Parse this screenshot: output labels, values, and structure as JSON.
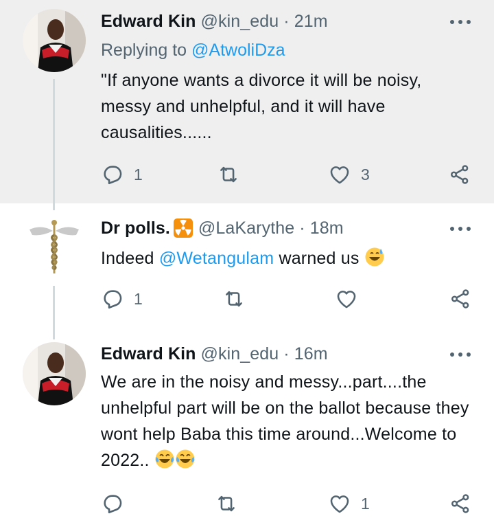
{
  "tweets": [
    {
      "author_name": "Edward Kin",
      "handle": "@kin_edu",
      "separator": "·",
      "time": "21m",
      "replying_prefix": "Replying to",
      "replying_handle": "@AtwoliDza",
      "text": "\"If anyone wants a divorce it will be noisy, messy and unhelpful, and it will have causalities......",
      "reply_count": "1",
      "retweet_count": "",
      "like_count": "3"
    },
    {
      "author_name": "Dr polls.",
      "handle": "@LaKarythe",
      "separator": "·",
      "time": "18m",
      "text_before": "Indeed ",
      "mention": "@Wetangulam",
      "text_after": " warned us",
      "reply_count": "1",
      "retweet_count": "",
      "like_count": ""
    },
    {
      "author_name": "Edward Kin",
      "handle": "@kin_edu",
      "separator": "·",
      "time": "16m",
      "text": "We are in the noisy and messy...part....the unhelpful part will be on the ballot because they wont help Baba this time around...Welcome to 2022..",
      "reply_count": "",
      "retweet_count": "",
      "like_count": "1"
    }
  ],
  "icons": [
    "reply-icon",
    "retweet-icon",
    "like-icon",
    "share-icon",
    "more-icon",
    "radioactive-badge-icon",
    "sweat-smile-emoji",
    "tears-of-joy-emoji"
  ],
  "colors": {
    "link": "#1d9bf0",
    "secondary_text": "#536471",
    "highlight_bg": "#efefef",
    "thread_line": "#cfd9de"
  }
}
